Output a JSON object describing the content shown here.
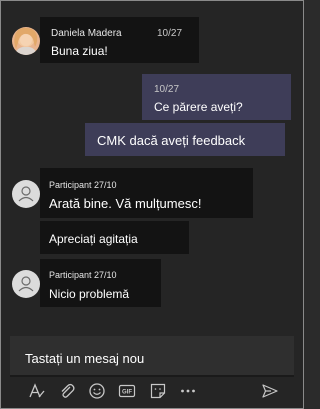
{
  "messages": [
    {
      "sender": "Daniela Madera",
      "time": "10/27",
      "text": "Buna ziua!"
    },
    {
      "sender": "",
      "time": "10/27",
      "text": "Ce părere aveți?"
    },
    {
      "sender": "",
      "time": "",
      "text": "CMK dacă aveți feedback"
    },
    {
      "sender": "Participant 27/10",
      "time": "",
      "text": "Arată bine. Vă mulțumesc!"
    },
    {
      "sender": "",
      "time": "",
      "text": "Apreciați agitația"
    },
    {
      "sender": "Participant 27/10",
      "time": "",
      "text": "Nicio problemă"
    }
  ],
  "compose": {
    "placeholder": "Tastați un mesaj nou"
  },
  "toolbar": {
    "icons": [
      "format-icon",
      "attach-icon",
      "emoji-icon",
      "gif-icon",
      "sticker-icon",
      "more-icon",
      "send-icon"
    ]
  },
  "colors": {
    "background": "#252525",
    "incoming_bubble": "#131313",
    "outgoing_bubble": "#3e3d58",
    "text": "#ffffff"
  }
}
